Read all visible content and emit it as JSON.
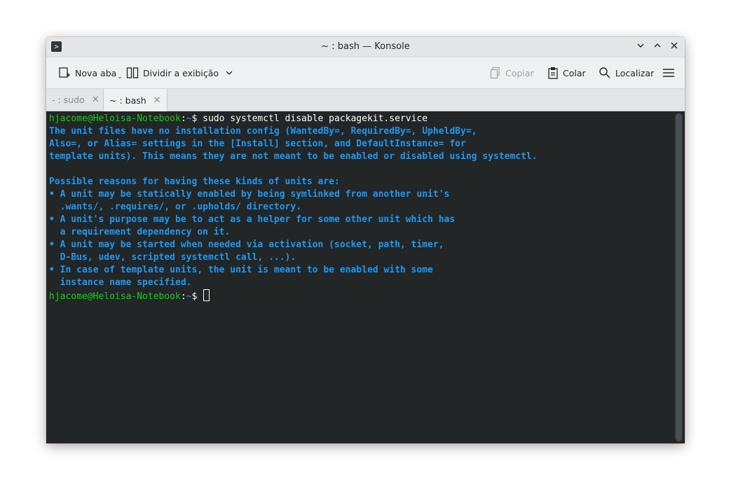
{
  "window": {
    "title": "~ : bash — Konsole"
  },
  "titlebar_buttons": {
    "minimize": "⌄",
    "maximize": "⌃",
    "close": "✕"
  },
  "toolbar": {
    "new_tab": "Nova aba",
    "split_view": "Dividir a exibição",
    "copy": "Copiar",
    "paste": "Colar",
    "find": "Localizar"
  },
  "tabs": [
    {
      "label": "- : sudo",
      "active": false
    },
    {
      "label": "~ : bash",
      "active": true
    }
  ],
  "terminal": {
    "prompt_user": "hjacome@Heloisa-Notebook",
    "prompt_sep": ":",
    "prompt_path": "~",
    "prompt_symbol": "$ ",
    "command": "sudo systemctl disable packagekit.service",
    "output_lines": [
      "The unit files have no installation config (WantedBy=, RequiredBy=, UpheldBy=,",
      "Also=, or Alias= settings in the [Install] section, and DefaultInstance= for",
      "template units). This means they are not meant to be enabled or disabled using systemctl.",
      "",
      "Possible reasons for having these kinds of units are:",
      "• A unit may be statically enabled by being symlinked from another unit's",
      "  .wants/, .requires/, or .upholds/ directory.",
      "• A unit's purpose may be to act as a helper for some other unit which has",
      "  a requirement dependency on it.",
      "• A unit may be started when needed via activation (socket, path, timer,",
      "  D-Bus, udev, scripted systemctl call, ...).",
      "• In case of template units, the unit is meant to be enabled with some",
      "  instance name specified."
    ]
  },
  "colors": {
    "terminal_bg": "#232627",
    "accent_blue": "#1d99f3",
    "prompt_green": "#11d116"
  }
}
